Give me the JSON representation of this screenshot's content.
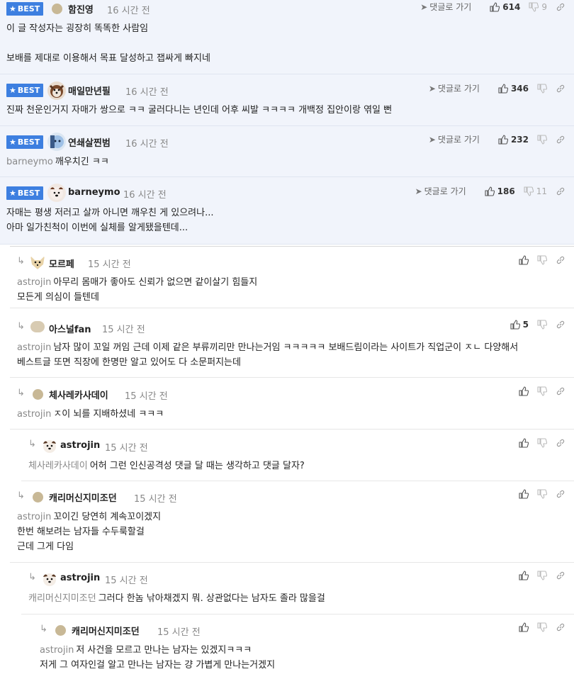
{
  "colors": {
    "best_badge": "#3d7fe0",
    "best_bg": "#f1f4fb",
    "mention": "#888888"
  },
  "best_label": "BEST",
  "goto_label": "댓글로 가기",
  "comments": [
    {
      "nick": "함진영",
      "time": "16 시간 전",
      "likes": "614",
      "dislikes": "9",
      "lines": [
        "이 글 작성자는 굉장히 똑똑한 사람임",
        "",
        "보배를 제대로 이용해서 목표 달성하고 잽싸게 빠지네"
      ]
    },
    {
      "nick": "매일만년필",
      "time": "16 시간 전",
      "likes": "346",
      "dislikes": "",
      "lines": [
        "진짜 천운인거지 자매가 쌍으로 ㅋㅋ 굴러다니는 년인데 어후 씨발 ㅋㅋㅋㅋ 개백정 집안이랑 엮일 뻔"
      ]
    },
    {
      "nick": "연쇄살찐범",
      "time": "16 시간 전",
      "likes": "232",
      "dislikes": "",
      "mention": "barneymo",
      "lines": [
        "깨우치긴 ㅋㅋ"
      ]
    },
    {
      "nick": "barneymo",
      "time": "16 시간 전",
      "likes": "186",
      "dislikes": "11",
      "lines": [
        "자매는 평생 저러고 살까 아니면 깨우친 게 있으려나...",
        "아마 일가친척이 이번에 실체를 알게됐을텐데..."
      ]
    },
    {
      "nick": "모르페",
      "time": "15 시간 전",
      "likes": "",
      "mention": "astrojin",
      "lines": [
        "아무리 몸매가 좋아도 신뢰가 없으면 같이살기 힘들지",
        "모든게 의심이 들텐데"
      ]
    },
    {
      "nick": "아스널fan",
      "time": "15 시간 전",
      "likes": "5",
      "mention": "astrojin",
      "lines": [
        "남자 많이 꼬일 꺼임 근데 이제 같은 부류끼리만 만나는거임 ㅋㅋㅋㅋㅋ 보배드림이라는 사이트가 직업군이 ㅈㄴ 다양해서",
        "베스트글 또면 직장에 한명만 알고 있어도 다 소문퍼지는데"
      ]
    },
    {
      "nick": "체사레카사데이",
      "time": "15 시간 전",
      "likes": "",
      "mention": "astrojin",
      "lines": [
        "ㅈ이 뇌를 지배하셨네 ㅋㅋㅋ"
      ]
    },
    {
      "nick": "astrojin",
      "time": "15 시간 전",
      "likes": "",
      "mention": "체사레카사데이",
      "lines": [
        "어허 그런 인신공격성 댓글 달 때는 생각하고 댓글 달자?"
      ]
    },
    {
      "nick": "캐리머신지미조던",
      "time": "15 시간 전",
      "likes": "",
      "mention": "astrojin",
      "lines": [
        "꼬이긴 당연히 계속꼬이겠지",
        "한번 해보려는 남자들 수두룩할걸",
        "근데 그게 다임"
      ]
    },
    {
      "nick": "astrojin",
      "time": "15 시간 전",
      "likes": "",
      "mention": "캐리머신지미조던",
      "lines": [
        "그러다 한놈 낚아채겠지 뭐. 상관없다는 남자도 졸라 많을걸"
      ]
    },
    {
      "nick": "캐리머신지미조던",
      "time": "15 시간 전",
      "likes": "",
      "mention": "astrojin",
      "lines": [
        "저 사건을 모르고 만나는 남자는 있겠지ㅋㅋㅋ",
        "저게 그 여자인걸 알고 만나는 남자는 걍 가볍게 만나는거겠지"
      ]
    }
  ]
}
